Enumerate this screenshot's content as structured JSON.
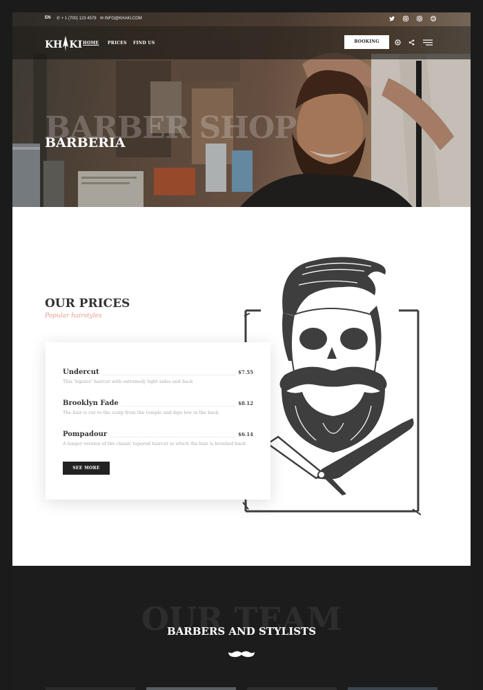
{
  "topbar": {
    "lang": "EN",
    "phone": "+ 1 (700) 123 4578",
    "email": "INFO@KHAKI.COM",
    "social": [
      "twitter-icon",
      "instagram-icon",
      "instagram-icon",
      "dribbble-icon"
    ]
  },
  "navbar": {
    "logo_left": "KH",
    "logo_right": "KI",
    "links": [
      "HOME",
      "PRICES",
      "FIND US"
    ],
    "booking": "BOOKING",
    "icons": [
      "settings-icon",
      "share-icon",
      "menu-icon"
    ]
  },
  "hero": {
    "ghost_title": "BARBER SHOP",
    "title": "BARBERIA"
  },
  "prices": {
    "title": "OUR PRICES",
    "subtitle": "Popular hairstyles",
    "items": [
      {
        "name": "Undercut",
        "price": "$7.55",
        "desc": "This 'hipster' haircut with extremely tight sides and back"
      },
      {
        "name": "Brooklyn Fade",
        "price": "$8.12",
        "desc": "The hair is cut to the scalp from the temple and dips low in the back"
      },
      {
        "name": "Pompadour",
        "price": "$6.14",
        "desc": "A longer version of the classic tapered haircut in which the hair is brushed back"
      }
    ],
    "see_more": "SEE MORE"
  },
  "team": {
    "ghost_title": "OUR TEAM",
    "title": "BARBERS AND STYLISTS"
  },
  "colors": {
    "accent": "#e8998f",
    "dark": "#1c1c1c",
    "frame": "#1b1b1b"
  }
}
